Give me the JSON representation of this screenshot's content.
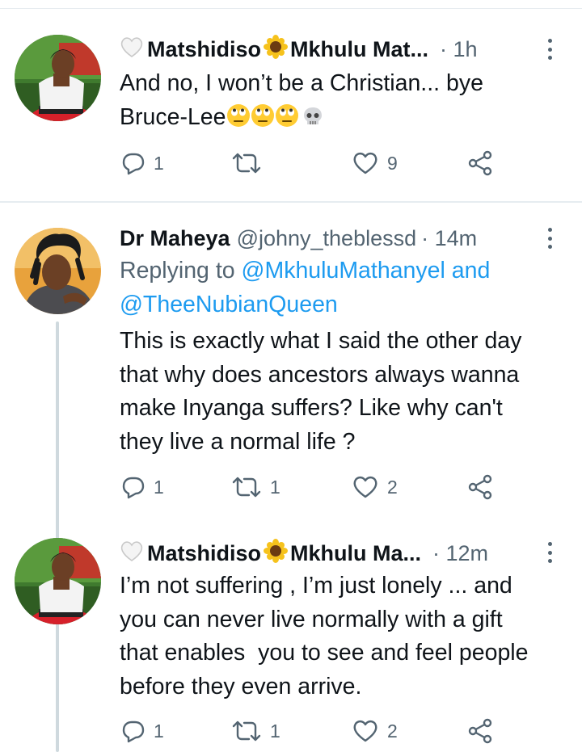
{
  "tweets": [
    {
      "name": "Matshidiso",
      "name_tail": "Mkhulu Mat...",
      "time": "· 1h",
      "text_line1": "And no, I won’t be a Christian... bye",
      "text_line2": "Bruce-Lee",
      "replies": "1",
      "retweets": "",
      "likes": "9"
    },
    {
      "name": "Dr Maheya",
      "handle": "@johny_theblessd",
      "time": "· 14m",
      "replying_label": "Replying to",
      "reply_user1": "@MkhuluMathanyel",
      "reply_and": "and",
      "reply_user2": "@TheeNubianQueen",
      "lines": [
        "This is exactly what I said the other day",
        "that why does ancestors always wanna",
        "make Inyanga suffers? Like why can't",
        "they live a normal life ?"
      ],
      "replies": "1",
      "retweets": "1",
      "likes": "2"
    },
    {
      "name": "Matshidiso",
      "name_tail": "Mkhulu Ma...",
      "time": "· 12m",
      "lines": [
        "I’m not suffering , I’m just lonely ... and",
        "you can never live normally with a gift",
        "that enables  you to see and feel people",
        "before they even arrive."
      ],
      "replies": "1",
      "retweets": "1",
      "likes": "2"
    }
  ],
  "colors": {
    "link": "#1d9bf0",
    "secondary_text": "#536471",
    "divider": "#e6ecf0",
    "thread_line": "#cfd9de"
  },
  "icons": [
    "white-heart-icon",
    "sunflower-icon",
    "eye-roll-emoji-icon",
    "skull-emoji-icon",
    "reply-icon",
    "retweet-icon",
    "like-icon",
    "share-icon",
    "more-icon"
  ]
}
